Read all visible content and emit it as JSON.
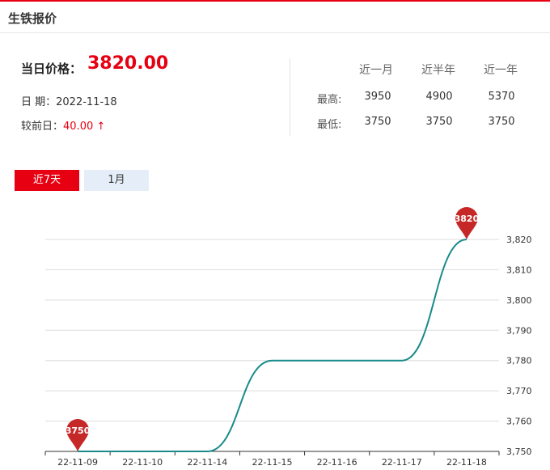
{
  "header": {
    "title": "生铁报价"
  },
  "price": {
    "label": "当日价格：",
    "value": "3820.00",
    "date_label": "日  期：",
    "date": "2022-11-18",
    "change_label": "较前日：",
    "change_value": "40.00 ↑"
  },
  "stats": {
    "columns": [
      "近一月",
      "近半年",
      "近一年"
    ],
    "rows": [
      {
        "label": "最高:",
        "values": [
          "3950",
          "4900",
          "5370"
        ]
      },
      {
        "label": "最低:",
        "values": [
          "3750",
          "3750",
          "3750"
        ]
      }
    ]
  },
  "tabs": [
    {
      "label": "近7天",
      "active": true
    },
    {
      "label": "1月",
      "active": false
    }
  ],
  "colors": {
    "accent": "#e60012",
    "line": "#1a8a8a",
    "pin": "#c62828",
    "grid": "#dddddd"
  },
  "chart_data": {
    "type": "line",
    "categories": [
      "22-11-09",
      "22-11-10",
      "22-11-14",
      "22-11-15",
      "22-11-16",
      "22-11-17",
      "22-11-18"
    ],
    "series": [
      {
        "values": [
          3750,
          3750,
          3750,
          3780,
          3780,
          3780,
          3820
        ]
      }
    ],
    "ylim": [
      3750,
      3820
    ],
    "yticks": [
      3750,
      3760,
      3770,
      3780,
      3790,
      3800,
      3810,
      3820
    ],
    "ytick_labels": [
      "3,750",
      "3,760",
      "3,770",
      "3,780",
      "3,790",
      "3,800",
      "3,810",
      "3,820"
    ],
    "markers": [
      {
        "index": 0,
        "label": "3750"
      },
      {
        "index": 6,
        "label": "3820"
      }
    ],
    "grid": true,
    "smooth": true
  }
}
